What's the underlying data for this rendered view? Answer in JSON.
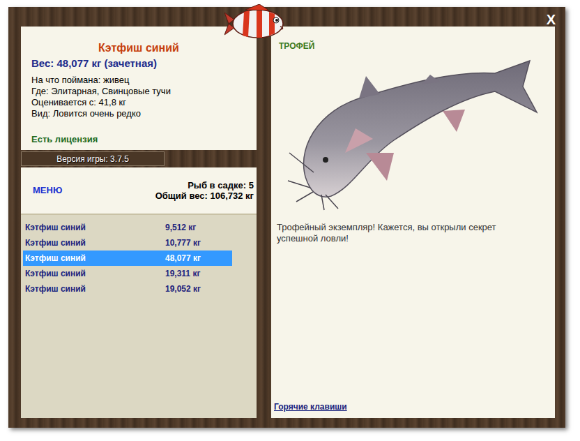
{
  "window": {
    "close": "X"
  },
  "fish": {
    "name": "Кэтфиш синий",
    "weight": "Вес: 48,077 кг (зачетная)",
    "details": [
      "На что поймана: живец",
      "Где: Элитарная, Свинцовые тучи",
      "Оценивается с: 41,8 кг",
      "Вид: Ловится очень редко"
    ],
    "license": "Есть лицензия"
  },
  "version": "Версия игры: 3.7.5",
  "menu": "МЕНЮ",
  "keepnet": {
    "count": "Рыб в садке: 5",
    "total": "Общий вес: 106,732 кг"
  },
  "catch_list": [
    {
      "name": "Кэтфиш синий",
      "weight": "9,512 кг",
      "selected": false
    },
    {
      "name": "Кэтфиш синий",
      "weight": "10,777 кг",
      "selected": false
    },
    {
      "name": "Кэтфиш синий",
      "weight": "48,077 кг",
      "selected": true
    },
    {
      "name": "Кэтфиш синий",
      "weight": "19,311 кг",
      "selected": false
    },
    {
      "name": "Кэтфиш синий",
      "weight": "19,052 кг",
      "selected": false
    }
  ],
  "trophy": {
    "badge": "ТРОФЕЙ",
    "message": "Трофейный экземпляр! Кажется, вы открыли секрет успешной ловли!"
  },
  "hotkeys": "Горячие клавиши"
}
